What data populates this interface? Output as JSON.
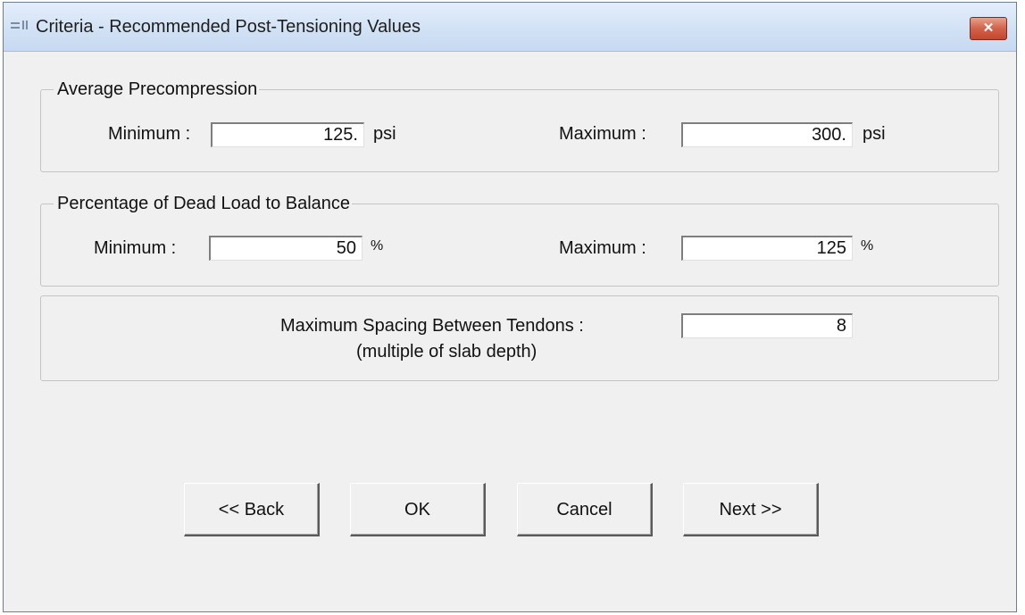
{
  "window": {
    "title": "Criteria - Recommended Post-Tensioning Values",
    "close_label": "✕"
  },
  "precompression": {
    "legend": "Average Precompression",
    "min_label": "Minimum :",
    "min_value": "125.",
    "min_unit": "psi",
    "max_label": "Maximum :",
    "max_value": "300.",
    "max_unit": "psi"
  },
  "dead_load": {
    "legend": "Percentage of Dead Load to Balance",
    "min_label": "Minimum :",
    "min_value": "50",
    "min_unit": "%",
    "max_label": "Maximum :",
    "max_value": "125",
    "max_unit": "%"
  },
  "spacing": {
    "label": "Maximum Spacing Between Tendons :",
    "sublabel": "(multiple of slab depth)",
    "value": "8"
  },
  "buttons": {
    "back": "<< Back",
    "ok": "OK",
    "cancel": "Cancel",
    "next": "Next >>"
  }
}
